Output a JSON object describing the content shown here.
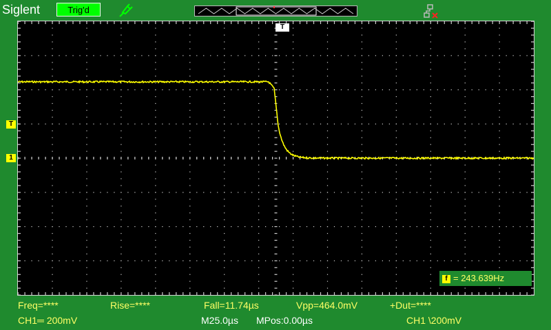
{
  "header": {
    "brand": "Siglent",
    "trigger_status": "Trig'd",
    "trigger_position_marker": "T"
  },
  "icons": {
    "probe": "probe-icon",
    "network": "network-disconnected-icon",
    "trigger_level": "trigger-level-marker-icon",
    "channel1": "channel1-ground-marker-icon",
    "trigger_point": "trigger-point-marker-icon"
  },
  "markers": {
    "trigger_level": "T",
    "channel1": "1",
    "freq_counter": "f"
  },
  "freq_counter": {
    "value": "= 243.639Hz"
  },
  "measurements": {
    "freq": "Freq=****",
    "rise": "Rise=****",
    "fall": "Fall=11.74µs",
    "vpp": "Vpp=464.0mV",
    "duty": "+Dut=****"
  },
  "status": {
    "ch1_scale": "CH1═ 200mV",
    "timebase": "M25.0µs",
    "mpos": "MPos:0.00µs",
    "trigger": "CH1 \\200mV"
  },
  "colors": {
    "bezel": "#1f8a2e",
    "trace": "#ffff00",
    "grid": "#d0d0d0",
    "text": "#ffff66",
    "trig_badge": "#00ff00"
  }
}
